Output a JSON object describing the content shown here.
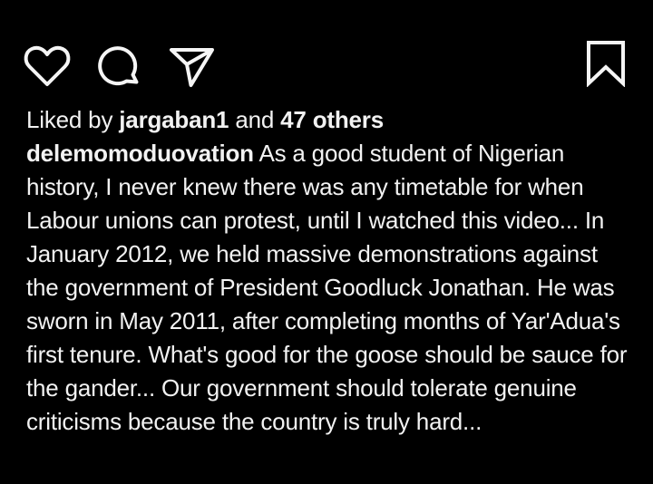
{
  "actions": {
    "like_icon": "heart-outline",
    "comment_icon": "speech-bubble-outline",
    "share_icon": "paper-plane-outline",
    "save_icon": "bookmark-outline"
  },
  "likes": {
    "prefix": "Liked by",
    "username": "jargaban1",
    "connector": "and",
    "others": "47 others"
  },
  "caption": {
    "username": "delemomoduovation",
    "text": "As a good student of Nigerian history, I never knew there was any timetable for when Labour unions can protest, until I watched this video... In January 2012, we held massive demonstrations against the government of President Goodluck Jonathan. He was sworn in May 2011, after completing months of Yar'Adua's first tenure. What's good for the goose should be sauce for the gander... Our government should tolerate genuine criticisms because the country is truly hard..."
  },
  "colors": {
    "background": "#000000",
    "text": "#f2f2f2"
  }
}
